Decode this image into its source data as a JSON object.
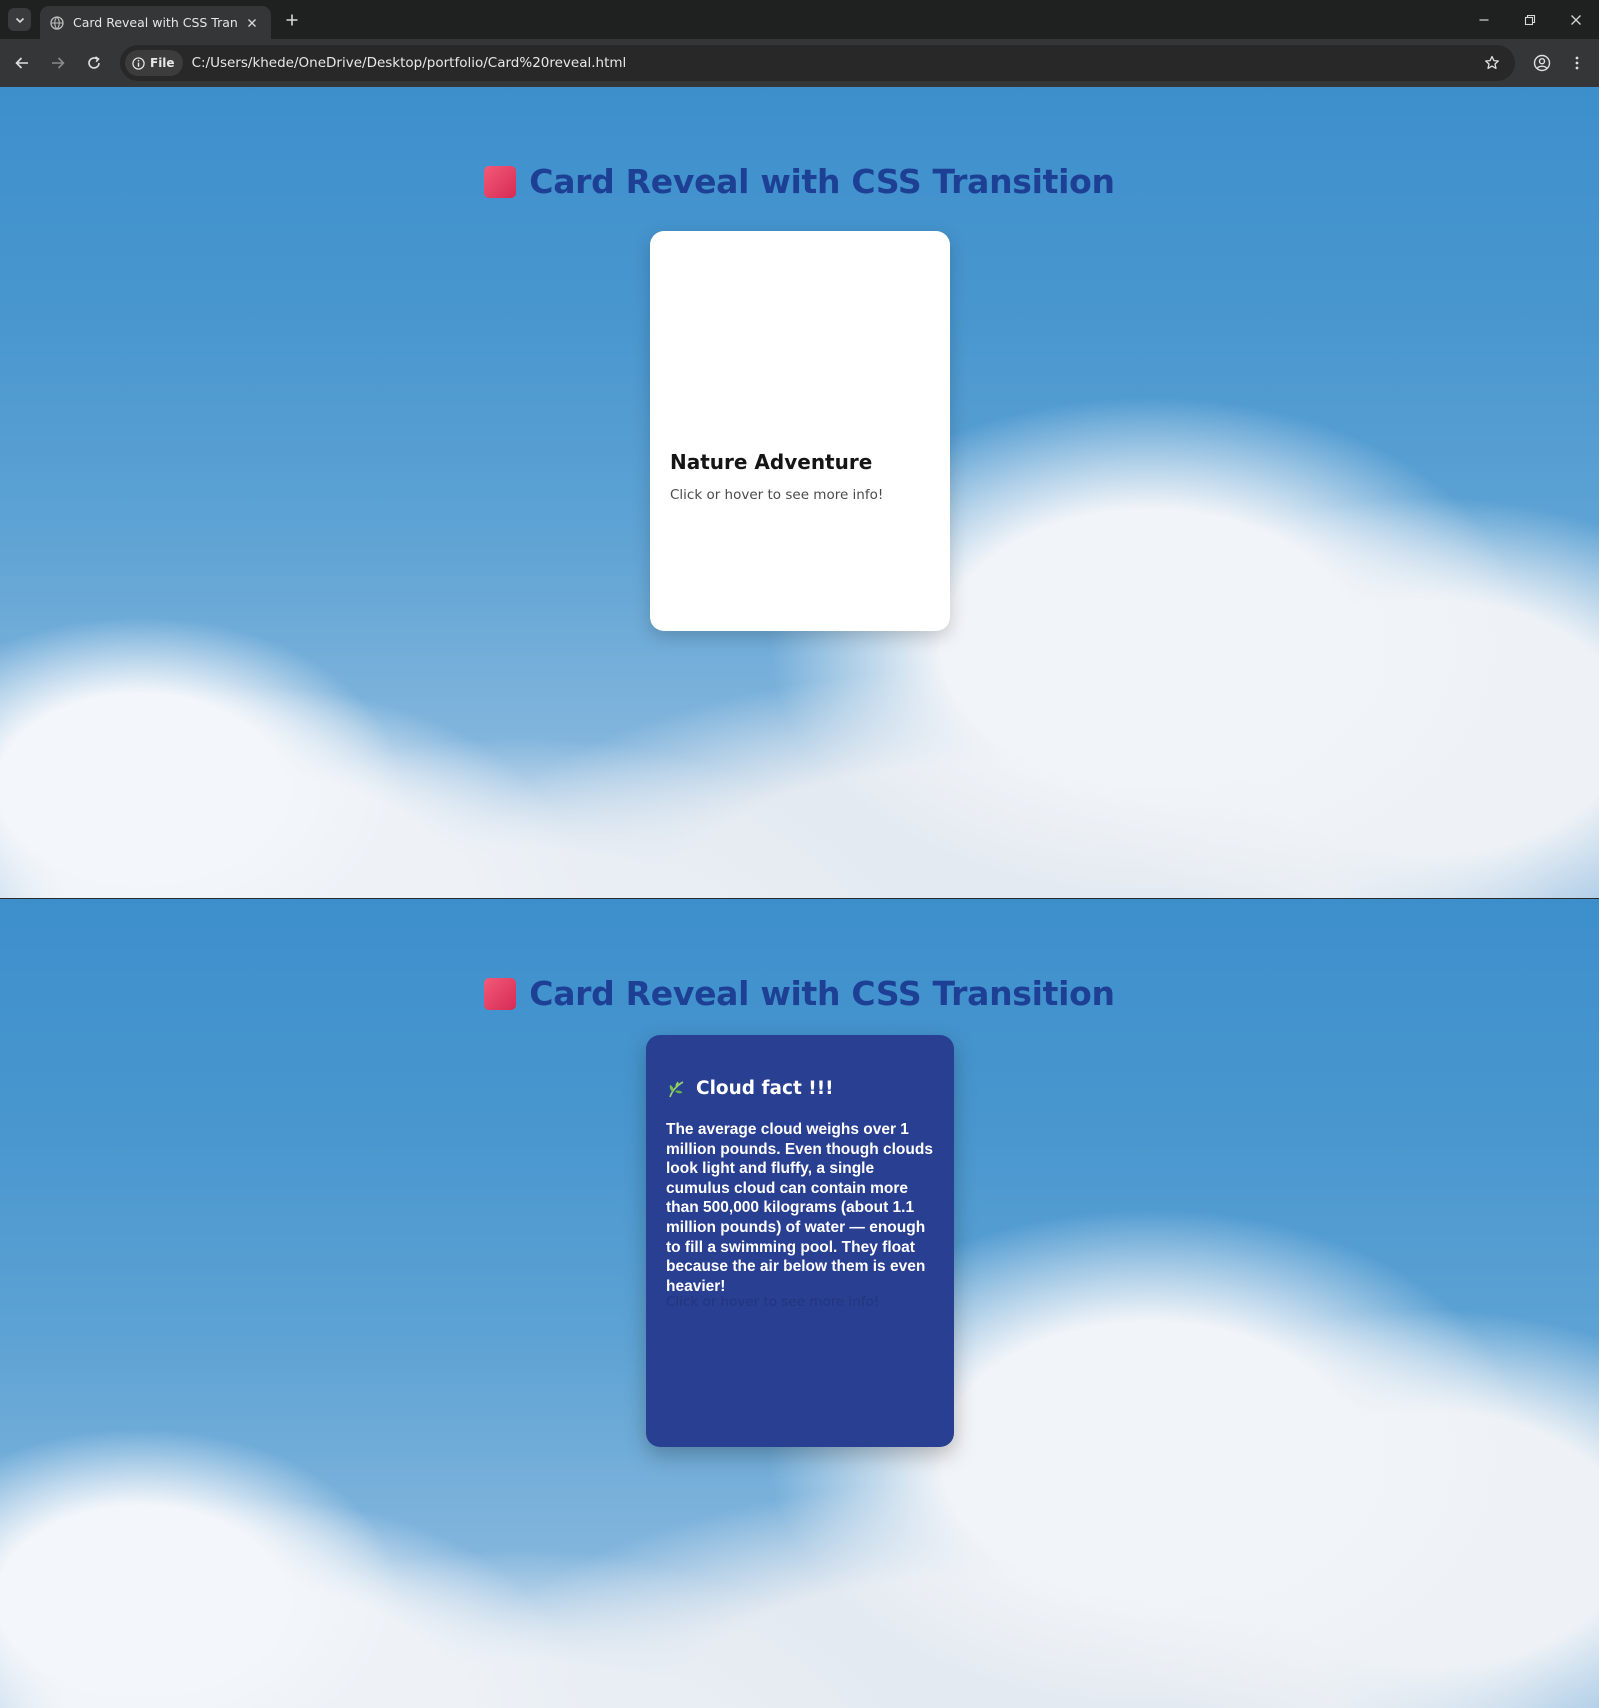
{
  "browser": {
    "tab_title": "Card Reveal with CSS Transition",
    "site_chip_label": "File",
    "url": "C:/Users/khede/OneDrive/Desktop/portfolio/Card%20reveal.html"
  },
  "page": {
    "heading": "Card Reveal with CSS Transition",
    "heading_icon_color": "#e0365e",
    "heading_color": "#1d3f94"
  },
  "card_front": {
    "title": "Nature Adventure",
    "subtitle": "Click or hover to see more info!"
  },
  "card_back": {
    "title": "Cloud fact !!!",
    "body": "The average cloud weighs over 1 million pounds. Even though clouds look light and fluffy, a single cumulus cloud can contain more than 500,000 kilograms (about 1.1 million pounds) of water — enough to fill a swimming pool. They float because the air below them is even heavier!",
    "subtitle": "Click or hover to see more info!",
    "background_color": "#283f92"
  }
}
